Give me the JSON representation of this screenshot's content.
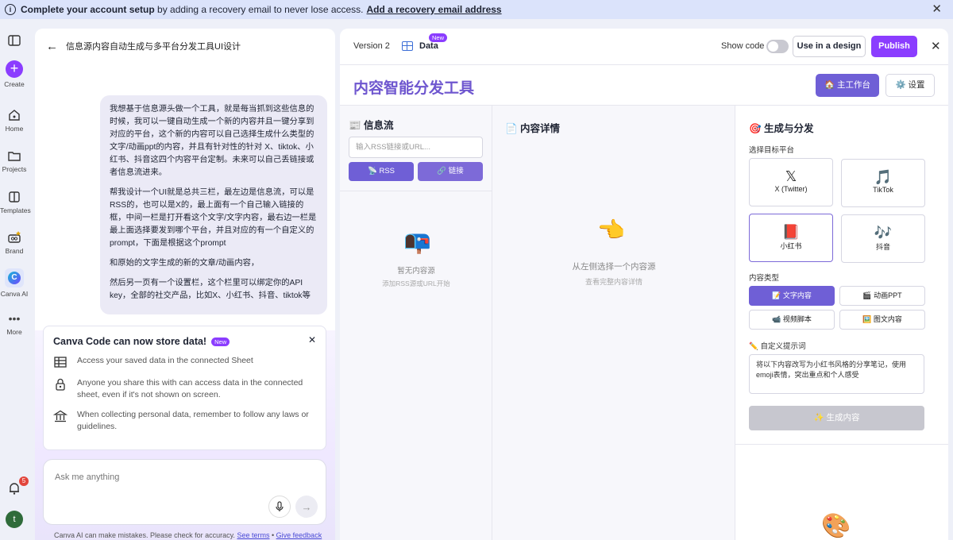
{
  "banner": {
    "bold_text": "Complete your account setup",
    "text": " by adding a recovery email to never lose access.",
    "link": "Add a recovery email address"
  },
  "rail": {
    "create": "Create",
    "home": "Home",
    "projects": "Projects",
    "templates": "Templates",
    "brand": "Brand",
    "canva_ai": "Canva AI",
    "more": "More",
    "notification_count": "5",
    "avatar_letter": "t"
  },
  "chat": {
    "title": "信息源内容自动生成与多平台分发工具UI设计",
    "message": [
      "我想基于信息源头做一个工具，就是每当抓到这些信息的时候，我可以一键自动生成一个新的内容并且一键分享到对应的平台，这个新的内容可以自己选择生成什么类型的文字/动画ppt的内容，并且有针对性的针对 X、tiktok、小红书、抖音这四个内容平台定制。未来可以自己丢链接或者信息流进来。",
      "帮我设计一个UI就是总共三栏，最左边是信息流，可以是RSS的，也可以是X的，最上面有一个自己输入链接的框，中间一栏是打开看这个文字/文字内容，最右边一栏是最上面选择要发到哪个平台，并且对应的有一个自定义的prompt，下面是根据这个prompt",
      "和原始的文字生成的新的文章/动画内容，",
      "然后另一页有一个设置栏，这个栏里可以绑定你的API key，全部的社交产品，比如X、小红书、抖音、tiktok等"
    ],
    "notice": {
      "title": "Canva Code can now store data!",
      "badge": "New",
      "items": [
        "Access your saved data in the connected Sheet",
        "Anyone you share this with can access data in the connected sheet, even if it's not shown on screen.",
        "When collecting personal data, remember to follow any laws or guidelines."
      ]
    },
    "input_placeholder": "Ask me anything",
    "disclaimer": "Canva AI can make mistakes. Please check for accuracy.",
    "terms_link": "See terms",
    "feedback_link": "Give feedback",
    "separator": "•"
  },
  "toolbar": {
    "version": "Version 2",
    "data_tab": "Data",
    "data_badge": "New",
    "show_code": "Show code",
    "use_in_design": "Use in a design",
    "publish": "Publish"
  },
  "app": {
    "title": "内容智能分发工具",
    "main_button": "🏠 主工作台",
    "settings_button": "⚙️ 设置",
    "feed": {
      "title": "📰 信息流",
      "input_placeholder": "输入RSS链接或URL...",
      "rss_button": "📡 RSS",
      "link_button": "🔗 链接",
      "empty_title": "暂无内容源",
      "empty_sub": "添加RSS源或URL开始"
    },
    "detail": {
      "title": "📄 内容详情",
      "empty_title": "从左侧选择一个内容源",
      "empty_sub": "查看完整内容详情"
    },
    "publish": {
      "title": "🎯 生成与分发",
      "platform_label": "选择目标平台",
      "platforms": [
        {
          "icon": "𝕏",
          "name": "X (Twitter)"
        },
        {
          "icon": "🎵",
          "name": "TikTok"
        },
        {
          "icon": "📕",
          "name": "小红书"
        },
        {
          "icon": "🎶",
          "name": "抖音"
        }
      ],
      "type_label": "内容类型",
      "types": [
        "📝 文字内容",
        "🎬 动画PPT",
        "📹 视频脚本",
        "🖼️ 图文内容"
      ],
      "prompt_label": "✏️ 自定义提示词",
      "prompt_value": "将以下内容改写为小红书风格的分享笔记，使用emoji表情，突出重点和个人感受",
      "generate_button": "✨ 生成内容"
    }
  }
}
